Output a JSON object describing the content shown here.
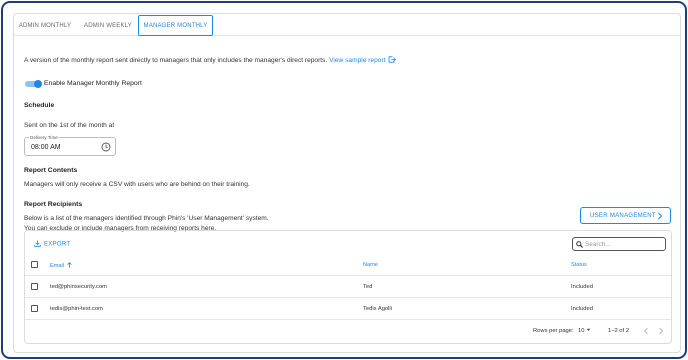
{
  "tabs": [
    {
      "label": "ADMIN MONTHLY",
      "active": false
    },
    {
      "label": "ADMIN WEEKLY",
      "active": false
    },
    {
      "label": "MANAGER MONTHLY",
      "active": true
    }
  ],
  "description": {
    "text": "A version of the monthly report sent directly to managers that only includes the manager's direct reports.",
    "link_label": "View sample report",
    "link_icon": "external-link-icon"
  },
  "toggle": {
    "label": "Enable Manager Monthly Report",
    "enabled": true
  },
  "schedule": {
    "title": "Schedule",
    "subtitle": "Sent on the 1st of the month at",
    "delivery_time_label": "Delivery Time",
    "delivery_time_value": "08:00 AM",
    "icon": "clock-icon"
  },
  "report_contents": {
    "title": "Report Contents",
    "text": "Managers will only receive a CSV with users who are behind on their training."
  },
  "recipients": {
    "title": "Report Recipients",
    "line1": "Below is a list of the managers identified through Phin's 'User Management' system.",
    "line2": "You can exclude or include managers from receiving reports here.",
    "user_management_button": "USER MANAGEMENT"
  },
  "table": {
    "export_label": "EXPORT",
    "search_placeholder": "Search...",
    "columns": {
      "email": "Email",
      "name": "Name",
      "status": "Status"
    },
    "rows": [
      {
        "email": "ted@phinsecurity.com",
        "name": "Ted",
        "status": "Included"
      },
      {
        "email": "tedis@phin-test.com",
        "name": "Tedis Agolli",
        "status": "Included"
      }
    ],
    "pagination": {
      "rows_per_page_label": "Rows per page:",
      "rows_per_page_value": "10",
      "range": "1–2 of 2"
    }
  },
  "colors": {
    "accent": "#1e88e5",
    "frame": "#1f3d7a"
  }
}
